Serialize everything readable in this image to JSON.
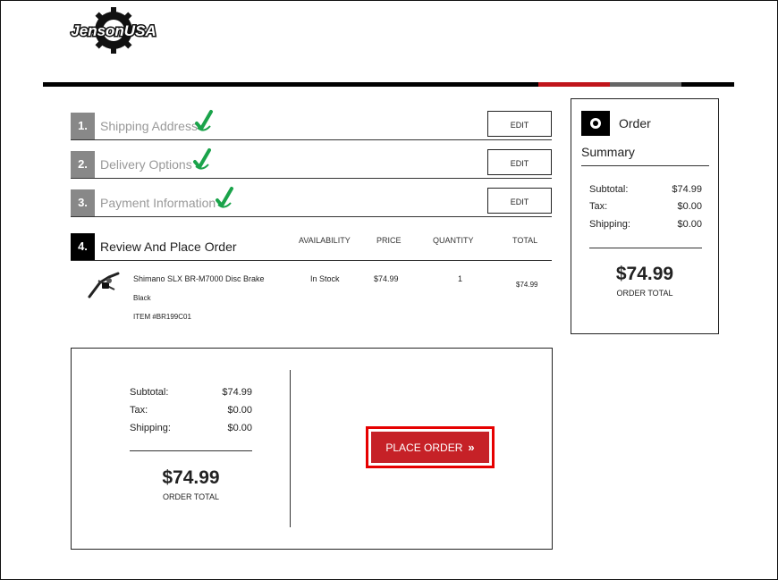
{
  "brand": {
    "logo_text": "JensonUSA"
  },
  "progress_bar": {
    "colors": [
      "#000000",
      "#c0151b",
      "#666666",
      "#000000"
    ]
  },
  "steps": [
    {
      "number": "1.",
      "title": "Shipping Address",
      "completed": true,
      "edit_label": "EDIT"
    },
    {
      "number": "2.",
      "title": "Delivery Options",
      "completed": true,
      "edit_label": "EDIT"
    },
    {
      "number": "3.",
      "title": "Payment Information",
      "completed": true,
      "edit_label": "EDIT"
    },
    {
      "number": "4.",
      "title": "Review And Place Order",
      "completed": false
    }
  ],
  "table": {
    "headers": {
      "availability": "AVAILABILITY",
      "price": "PRICE",
      "quantity": "QUANTITY",
      "total": "TOTAL"
    },
    "item": {
      "name": "Shimano SLX BR-M7000 Disc Brake",
      "variant": "Black",
      "item_number": "ITEM #BR199C01",
      "availability": "In Stock",
      "price": "$74.99",
      "quantity": "1",
      "total": "$74.99"
    }
  },
  "order_summary": {
    "title_line1": "Order",
    "title_line2": "Summary",
    "subtotal_label": "Subtotal:",
    "subtotal": "$74.99",
    "tax_label": "Tax:",
    "tax": "$0.00",
    "shipping_label": "Shipping:",
    "shipping": "$0.00",
    "total": "$74.99",
    "total_caption": "ORDER TOTAL"
  },
  "review": {
    "subtotal_label": "Subtotal:",
    "subtotal": "$74.99",
    "tax_label": "Tax:",
    "tax": "$0.00",
    "shipping_label": "Shipping:",
    "shipping": "$0.00",
    "total": "$74.99",
    "total_caption": "ORDER TOTAL",
    "place_order_label": "PLACE ORDER"
  },
  "colors": {
    "accent": "#c62127",
    "check": "#1aa34a",
    "highlight": "#e60000"
  }
}
